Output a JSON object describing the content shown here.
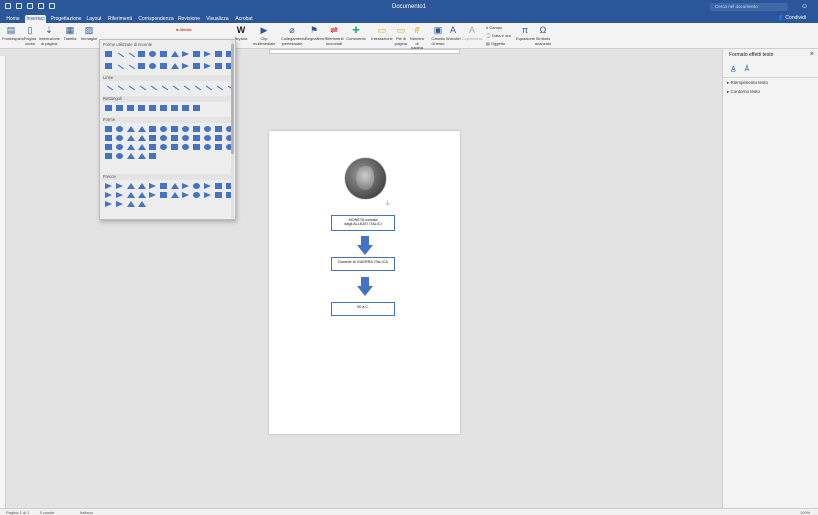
{
  "window": {
    "title": "Documento1",
    "search_placeholder": "Cerca nel documento",
    "share_label": "Condividi"
  },
  "tabs": [
    "Home",
    "Inserisci",
    "Progettazione",
    "Layout",
    "Riferimenti",
    "Corrispondenza",
    "Revisione",
    "Visualizza",
    "Acrobat"
  ],
  "ribbon": {
    "frontespizio": "Frontespizio",
    "pagina_vuota": "Pagina vuota",
    "interruzione": "Interruzione di pagina",
    "tabella": "Tabella",
    "immagini": "Immagini",
    "attivita": "Attività",
    "bryaria": "Bryaria",
    "clip": "Clip multimediale",
    "collegamento": "Collegamento ipertestuale",
    "segnalibro": "Segnalibro",
    "riferimenti_incrociati": "Riferimenti incrociati",
    "commento": "Commento",
    "intestazione": "Intestazione",
    "pie_di_pagina": "Piè di pagina",
    "numero_pagina": "Numero di pagina",
    "casella_testo": "Casella di testo",
    "wordart": "WordArt",
    "capolettera": "Capolettera",
    "campo": "Campo",
    "data_ora": "Data e ora",
    "oggetto": "Oggetto",
    "equazione": "Equazione",
    "simbolo": "Simbolo avanzato"
  },
  "shapes_menu": {
    "sections": [
      "Forme utilizzate di recente",
      "Linee",
      "Rettangoli",
      "Forme",
      "Frecce"
    ],
    "recent_count": 24,
    "lines_count": 12,
    "rect_count": 9,
    "basic_count": 41,
    "arrows_count": 28
  },
  "document": {
    "box1_line1": "MONETA coniata",
    "box1_line2": "dagli ALLEATI ITALICI",
    "box2": "Durante la GUERRA ITALICA",
    "box3": "90 a.C."
  },
  "panel": {
    "title": "Formato effetti testo",
    "item1": "Riempimento testo",
    "item2": "Contorno testo"
  },
  "status": {
    "page": "Pagina 1 di 1",
    "words": "0 parole",
    "language": "Italiano",
    "zoom": "100%"
  }
}
